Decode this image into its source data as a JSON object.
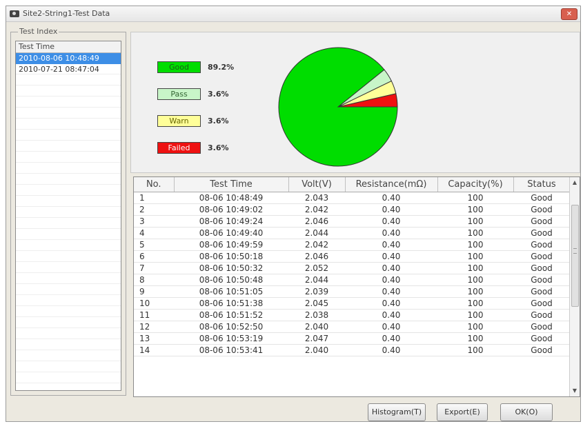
{
  "window": {
    "title": "Site2-String1-Test Data",
    "close_glyph": "✕"
  },
  "test_index": {
    "label": "Test Index",
    "column_header": "Test Time",
    "items": [
      "2010-08-06 10:48:49",
      "2010-07-21 08:47:04"
    ],
    "selected_index": 0
  },
  "chart_data": {
    "type": "pie",
    "categories": [
      "Good",
      "Pass",
      "Warn",
      "Failed"
    ],
    "values": [
      89.2,
      3.6,
      3.6,
      3.6
    ],
    "value_labels": [
      "89.2%",
      "3.6%",
      "3.6%",
      "3.6%"
    ],
    "colors": [
      "#00dd00",
      "#c8f5c8",
      "#ffff99",
      "#ee1111"
    ]
  },
  "table": {
    "columns": [
      "No.",
      "Test Time",
      "Volt(V)",
      "Resistance(mΩ)",
      "Capacity(%)",
      "Status"
    ],
    "rows": [
      [
        "1",
        "08-06 10:48:49",
        "2.043",
        "0.40",
        "100",
        "Good"
      ],
      [
        "2",
        "08-06 10:49:02",
        "2.042",
        "0.40",
        "100",
        "Good"
      ],
      [
        "3",
        "08-06 10:49:24",
        "2.046",
        "0.40",
        "100",
        "Good"
      ],
      [
        "4",
        "08-06 10:49:40",
        "2.044",
        "0.40",
        "100",
        "Good"
      ],
      [
        "5",
        "08-06 10:49:59",
        "2.042",
        "0.40",
        "100",
        "Good"
      ],
      [
        "6",
        "08-06 10:50:18",
        "2.046",
        "0.40",
        "100",
        "Good"
      ],
      [
        "7",
        "08-06 10:50:32",
        "2.052",
        "0.40",
        "100",
        "Good"
      ],
      [
        "8",
        "08-06 10:50:48",
        "2.044",
        "0.40",
        "100",
        "Good"
      ],
      [
        "9",
        "08-06 10:51:05",
        "2.039",
        "0.40",
        "100",
        "Good"
      ],
      [
        "10",
        "08-06 10:51:38",
        "2.045",
        "0.40",
        "100",
        "Good"
      ],
      [
        "11",
        "08-06 10:51:52",
        "2.038",
        "0.40",
        "100",
        "Good"
      ],
      [
        "12",
        "08-06 10:52:50",
        "2.040",
        "0.40",
        "100",
        "Good"
      ],
      [
        "13",
        "08-06 10:53:19",
        "2.047",
        "0.40",
        "100",
        "Good"
      ],
      [
        "14",
        "08-06 10:53:41",
        "2.040",
        "0.40",
        "100",
        "Good"
      ]
    ]
  },
  "buttons": {
    "histogram": "Histogram(T)",
    "export": "Export(E)",
    "ok": "OK(O)"
  }
}
